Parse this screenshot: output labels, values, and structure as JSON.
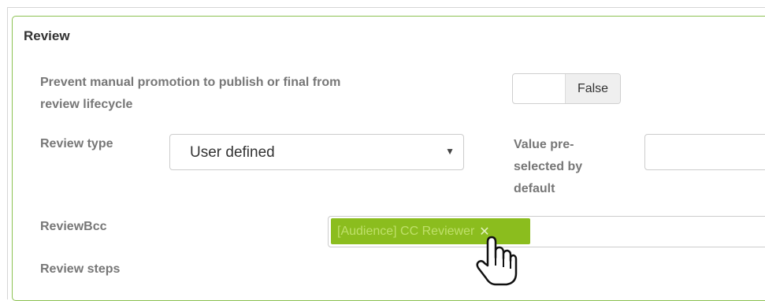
{
  "panel": {
    "title": "Review"
  },
  "fields": {
    "prevent_manual": {
      "label_line1": "Prevent manual promotion to publish or final from",
      "label_line2": "review lifecycle",
      "value": "False"
    },
    "review_type": {
      "label": "Review type",
      "selected": "User defined"
    },
    "value_preselected": {
      "label_line1": "Value pre-",
      "label_line2": "selected by",
      "label_line3": "default",
      "value": ""
    },
    "review_bcc": {
      "label": "ReviewBcc",
      "tags": [
        "[Audience] CC Reviewer"
      ],
      "remove_glyph": "✕"
    },
    "review_steps": {
      "label": "Review steps"
    }
  },
  "colors": {
    "panel_border": "#8cc152",
    "tag_background": "#8bbd1e",
    "tag_text": "#bfe06a"
  },
  "icons": {
    "select_caret": "▼",
    "cursor": "hand-pointer-icon"
  }
}
